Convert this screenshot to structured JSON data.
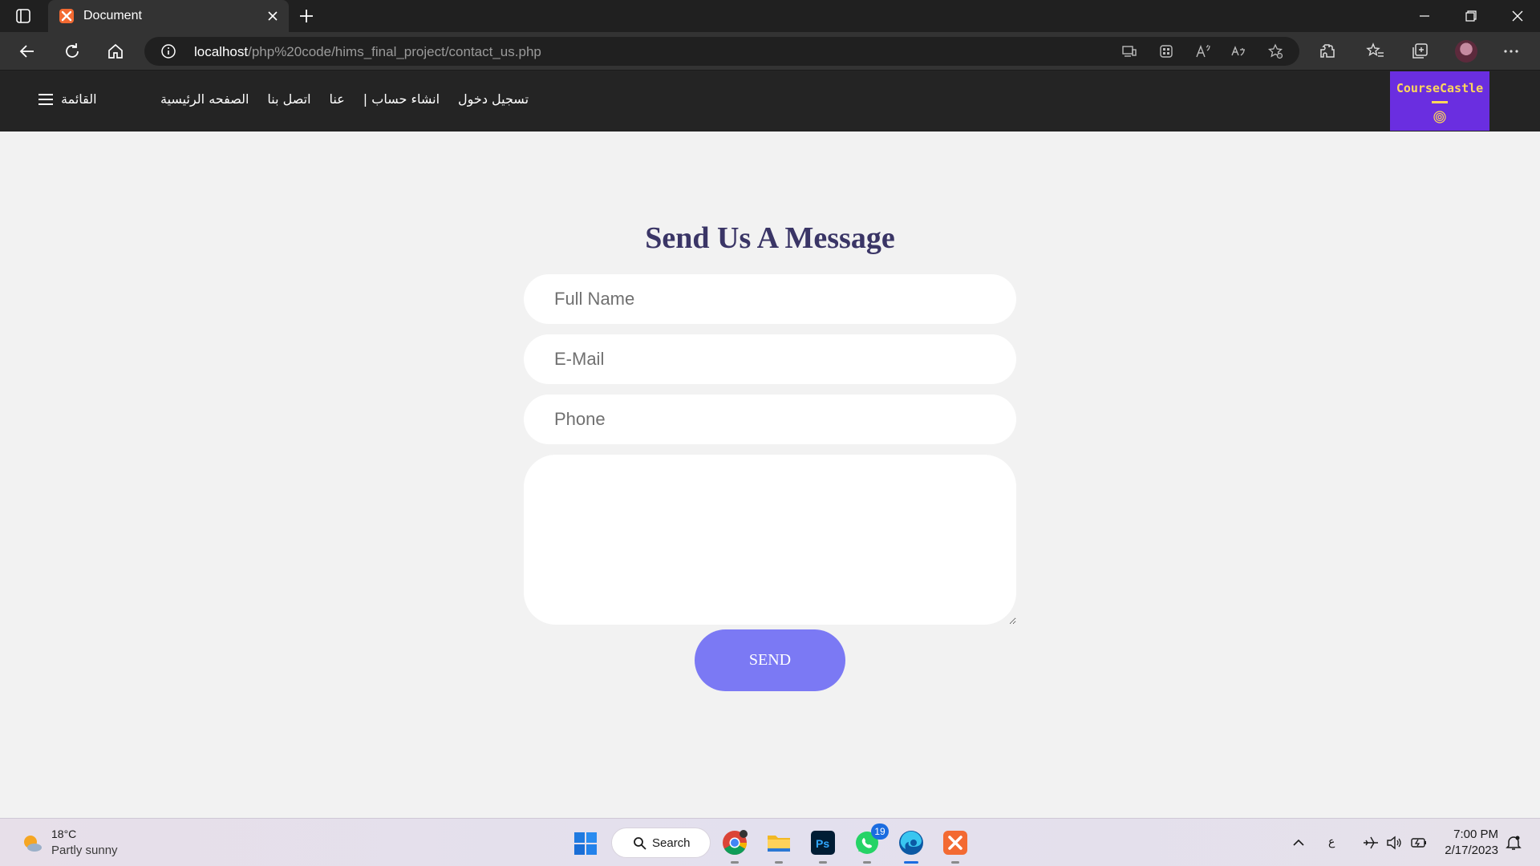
{
  "browser": {
    "tab_title": "Document",
    "url_host": "localhost",
    "url_path": "/php%20code/hims_final_project/contact_us.php"
  },
  "site": {
    "brand": "CourseCastle",
    "menu_label": "القائمة",
    "nav_links": [
      "الصفحه الرئيسية",
      "اتصل بنا",
      "عنا",
      "| انشاء حساب",
      "تسجيل دخول"
    ]
  },
  "form": {
    "title": "Send Us A Message",
    "full_name_placeholder": "Full Name",
    "email_placeholder": "E-Mail",
    "phone_placeholder": "Phone",
    "message_value": "",
    "send_label": "SEND"
  },
  "taskbar": {
    "weather_temp": "18°C",
    "weather_desc": "Partly sunny",
    "search_label": "Search",
    "whatsapp_badge": "19",
    "tray_lang": "ع",
    "clock_time": "7:00 PM",
    "clock_date": "2/17/2023"
  },
  "colors": {
    "navbar": "#242424",
    "brand_bg": "#6a2ee0",
    "brand_text": "#ffd75a",
    "title": "#3a3566",
    "send_button": "#7b79f4",
    "page_bg": "#f2f2f2"
  },
  "icons": [
    "tab-actions-icon",
    "close-icon",
    "new-tab-icon",
    "minimize-icon",
    "restore-icon",
    "back-icon",
    "refresh-icon",
    "home-icon",
    "info-icon",
    "shield-icon",
    "hamburger-icon",
    "search-icon",
    "windows-start-icon"
  ]
}
